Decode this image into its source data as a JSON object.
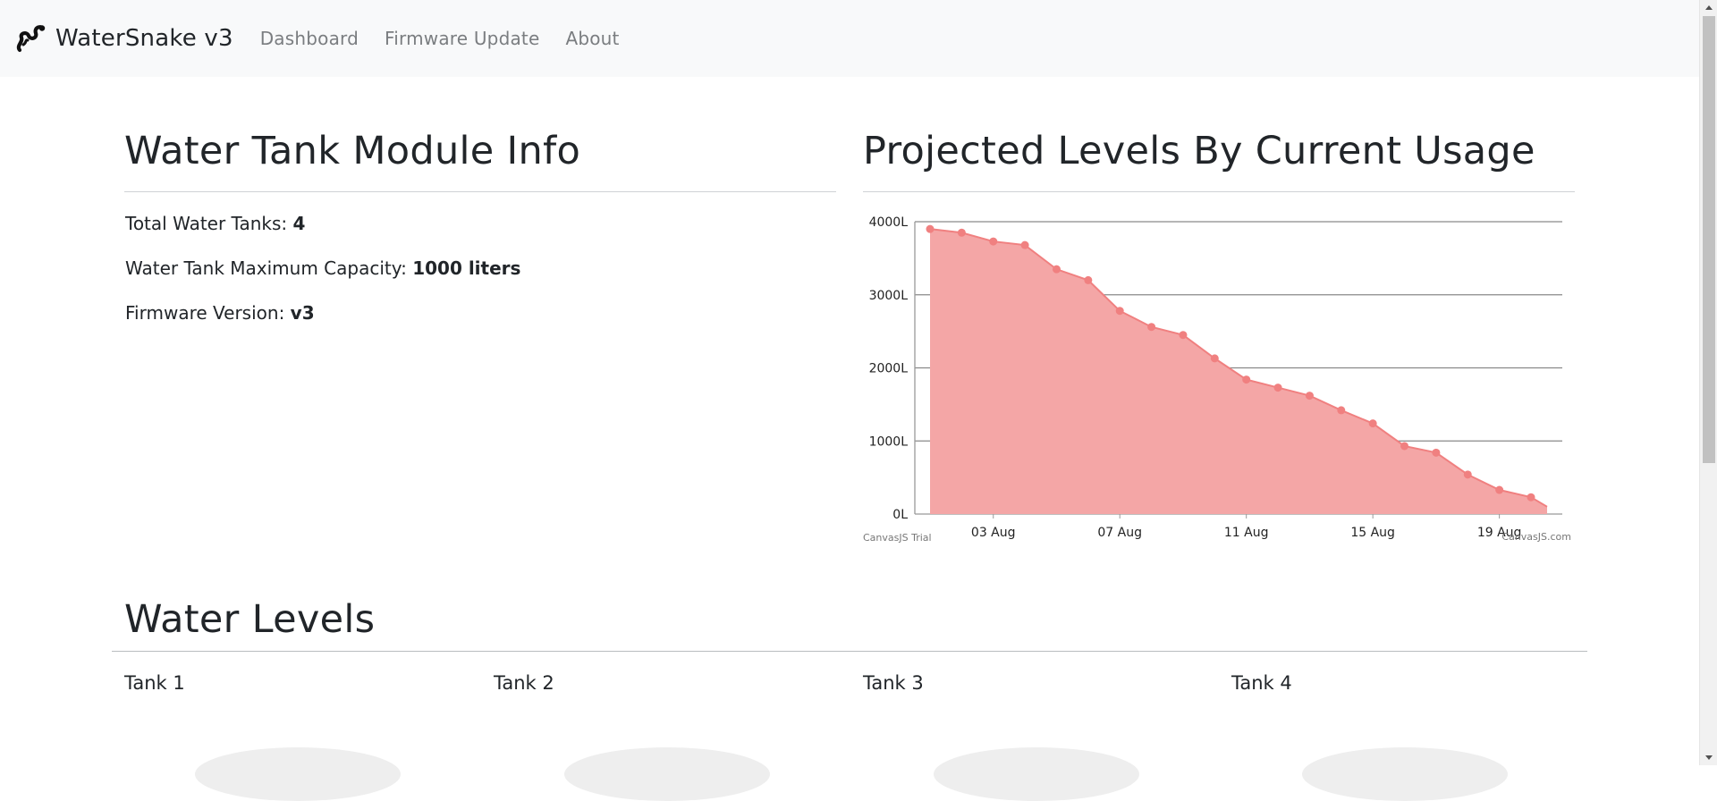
{
  "navbar": {
    "brand": "WaterSnake v3",
    "links": [
      {
        "label": "Dashboard"
      },
      {
        "label": "Firmware Update"
      },
      {
        "label": "About"
      }
    ]
  },
  "info": {
    "title": "Water Tank Module Info",
    "rows": [
      {
        "label": "Total Water Tanks:",
        "value": "4"
      },
      {
        "label": "Water Tank Maximum Capacity:",
        "value": "1000 liters"
      },
      {
        "label": "Firmware Version:",
        "value": "v3"
      }
    ]
  },
  "projection": {
    "title": "Projected Levels By Current Usage"
  },
  "chart_data": {
    "type": "area",
    "title": "",
    "xlabel": "",
    "ylabel": "",
    "x": [
      "01 Aug",
      "02 Aug",
      "03 Aug",
      "04 Aug",
      "05 Aug",
      "06 Aug",
      "07 Aug",
      "08 Aug",
      "09 Aug",
      "10 Aug",
      "11 Aug",
      "12 Aug",
      "13 Aug",
      "14 Aug",
      "15 Aug",
      "16 Aug",
      "17 Aug",
      "18 Aug",
      "19 Aug",
      "20 Aug"
    ],
    "series": [
      {
        "values": [
          3900,
          3850,
          3730,
          3680,
          3350,
          3200,
          2780,
          2560,
          2450,
          2130,
          1840,
          1730,
          1620,
          1420,
          1240,
          930,
          840,
          540,
          330,
          230
        ]
      }
    ],
    "x_tick_labels": [
      "03 Aug",
      "07 Aug",
      "11 Aug",
      "15 Aug",
      "19 Aug"
    ],
    "y_tick_labels": [
      "0L",
      "1000L",
      "2000L",
      "3000L",
      "4000L"
    ],
    "ylim": [
      0,
      4000
    ],
    "grid": true,
    "color": "#f08080",
    "fill_color": "#f4a6a6",
    "credit_left": "CanvasJS Trial",
    "credit_right": "CanvasJS.com"
  },
  "levels": {
    "title": "Water Levels",
    "tanks": [
      {
        "label": "Tank 1"
      },
      {
        "label": "Tank 2"
      },
      {
        "label": "Tank 3"
      },
      {
        "label": "Tank 4"
      }
    ]
  }
}
